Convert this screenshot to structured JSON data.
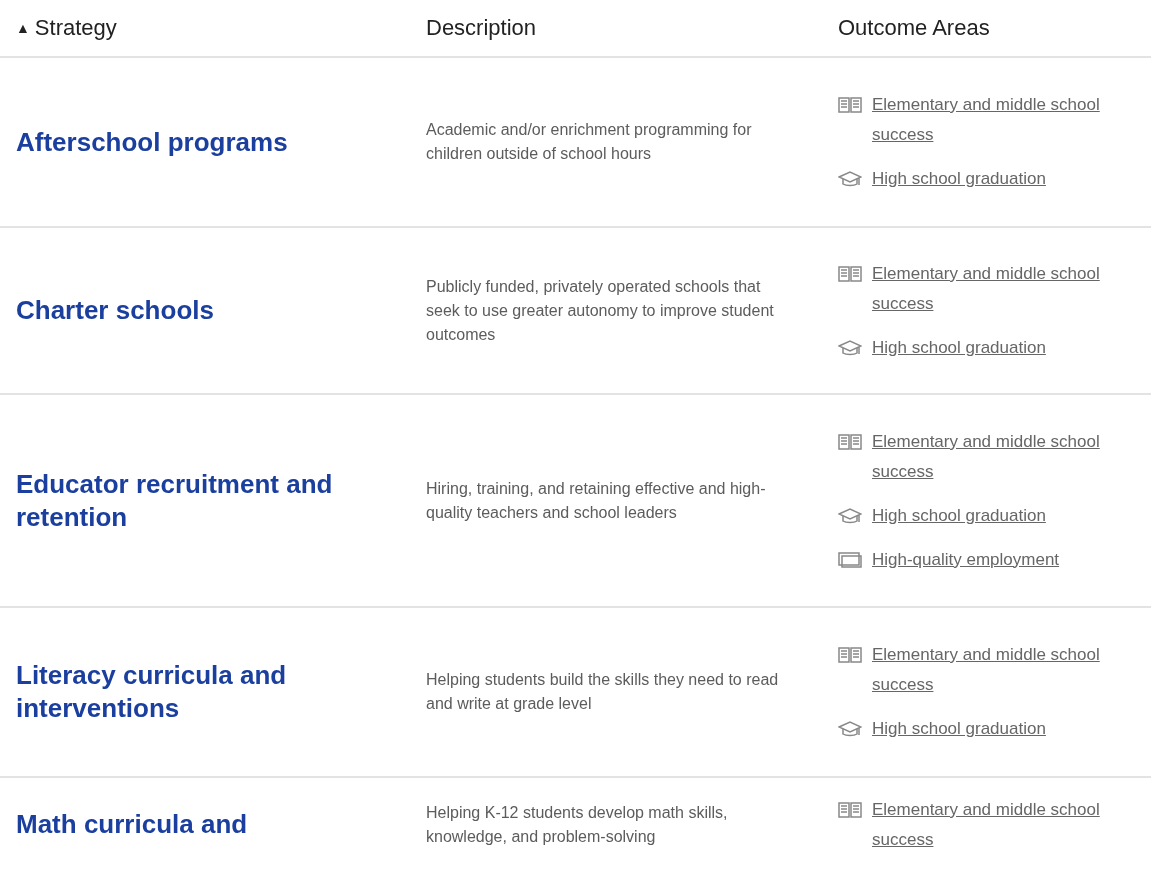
{
  "table": {
    "columns": [
      {
        "label": "Strategy",
        "sort_indicator": "▲"
      },
      {
        "label": "Description"
      },
      {
        "label": "Outcome Areas"
      }
    ],
    "rows": [
      {
        "strategy": "Afterschool programs",
        "description": "Academic and/or enrichment programming for children outside of school hours",
        "outcomes": [
          {
            "kind": "book",
            "label": "Elementary and middle school success"
          },
          {
            "kind": "cap",
            "label": "High school graduation"
          }
        ]
      },
      {
        "strategy": "Charter schools",
        "description": "Publicly funded, privately operated schools that seek to use greater autonomy to improve student outcomes",
        "outcomes": [
          {
            "kind": "book",
            "label": "Elementary and middle school success"
          },
          {
            "kind": "cap",
            "label": "High school graduation"
          }
        ]
      },
      {
        "strategy": "Educator recruitment and retention",
        "description": "Hiring, training, and retaining effective and high-quality teachers and school leaders",
        "outcomes": [
          {
            "kind": "book",
            "label": "Elementary and middle school success"
          },
          {
            "kind": "cap",
            "label": "High school graduation"
          },
          {
            "kind": "screen",
            "label": "High-quality employment"
          }
        ]
      },
      {
        "strategy": "Literacy curricula and interventions",
        "description": "Helping students build the skills they need to read and write at grade level",
        "outcomes": [
          {
            "kind": "book",
            "label": "Elementary and middle school success"
          },
          {
            "kind": "cap",
            "label": "High school graduation"
          }
        ]
      },
      {
        "strategy": "Math curricula and",
        "description": "Helping K-12 students develop math skills, knowledge, and problem-solving",
        "outcomes": [
          {
            "kind": "book",
            "label": "Elementary and middle school success"
          }
        ]
      }
    ]
  }
}
